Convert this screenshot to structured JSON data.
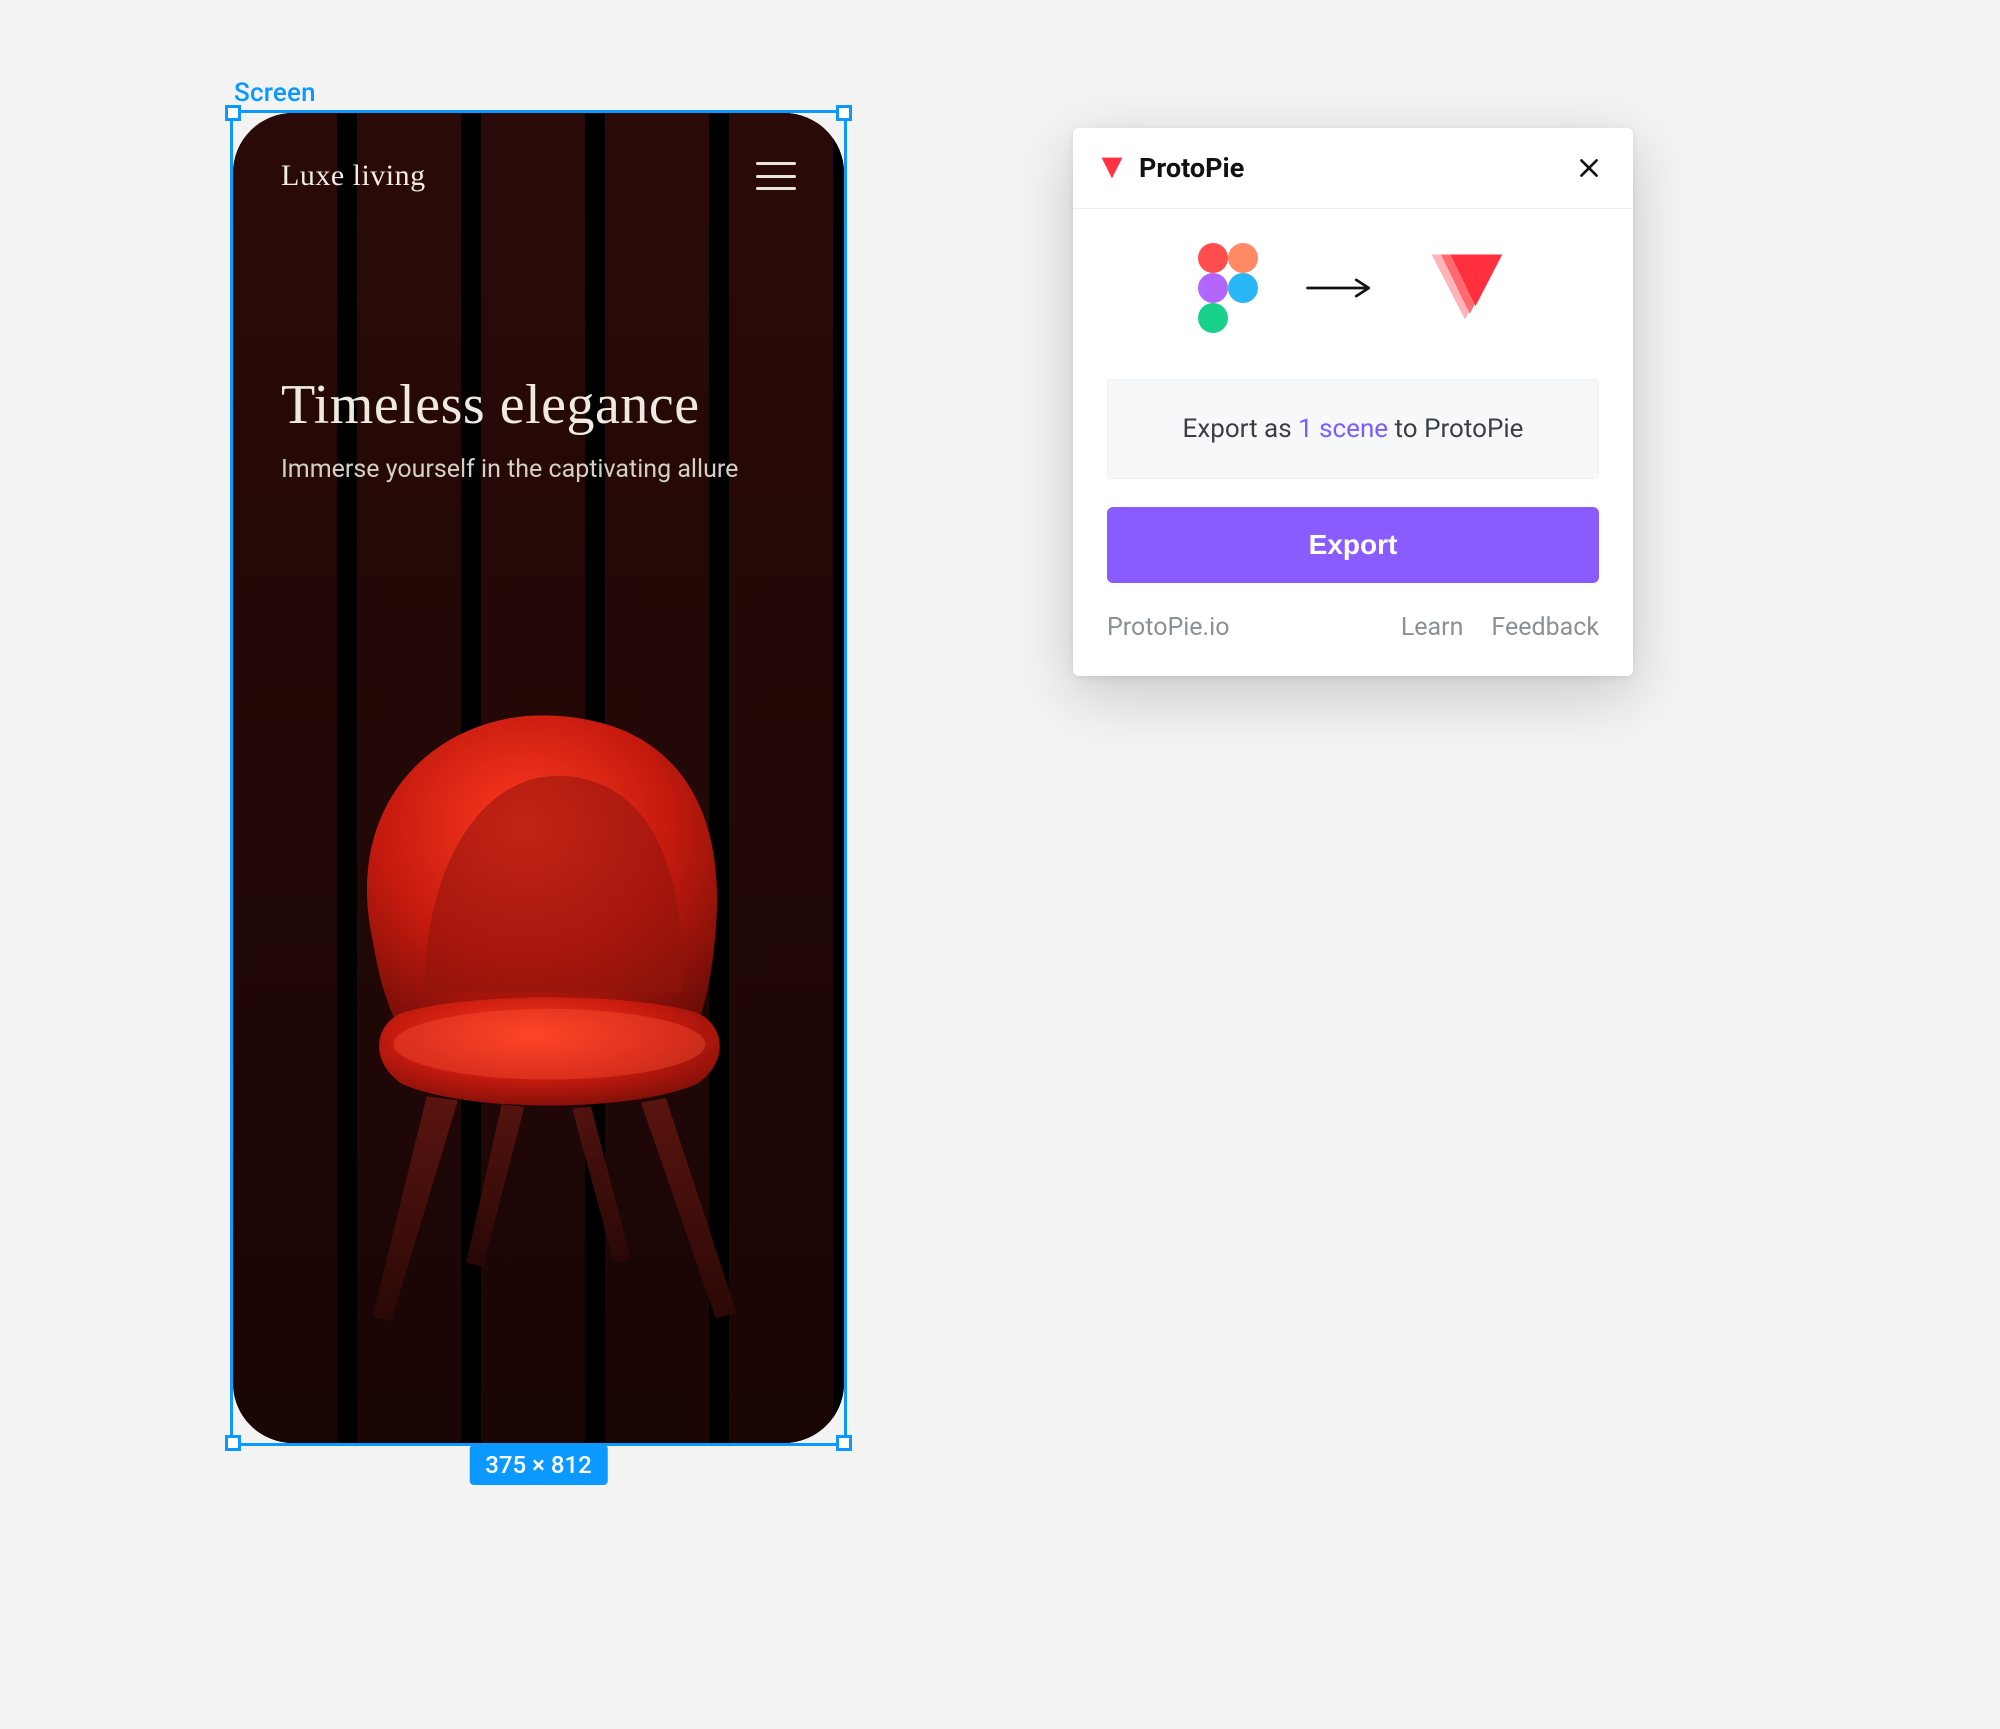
{
  "canvas": {
    "frame_label": "Screen",
    "dimensions_badge": "375 × 812"
  },
  "mockup": {
    "brand": "Luxe living",
    "headline": "Timeless elegance",
    "subhead": "Immerse yourself in the captivating allure"
  },
  "plugin": {
    "title": "ProtoPie",
    "info_prefix": "Export as ",
    "info_highlight": "1 scene",
    "info_suffix": " to ProtoPie",
    "export_label": "Export",
    "footer": {
      "site": "ProtoPie.io",
      "learn": "Learn",
      "feedback": "Feedback"
    }
  },
  "colors": {
    "selection": "#0b99ff",
    "export_button": "#8a5cff",
    "highlight": "#7a5cff"
  }
}
